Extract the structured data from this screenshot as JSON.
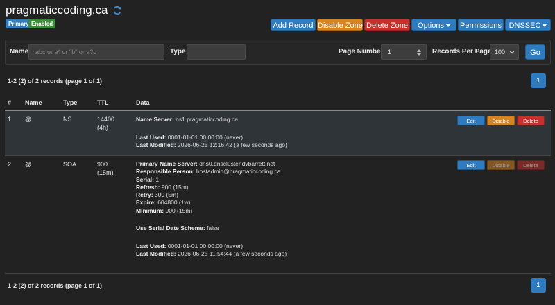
{
  "zone": {
    "name": "pragmaticcoding.ca",
    "badges": {
      "type": "Primary",
      "status": "Enabled"
    }
  },
  "toolbar": {
    "add_record": "Add Record",
    "disable_zone": "Disable Zone",
    "delete_zone": "Delete Zone",
    "options": "Options",
    "permissions": "Permissions",
    "dnssec": "DNSSEC"
  },
  "filter": {
    "name_label": "Name",
    "name_placeholder": "abc or a* or \"b\" or a?c",
    "type_label": "Type",
    "type_value": "",
    "page_number_label": "Page Number",
    "page_number_value": "1",
    "records_per_page_label": "Records Per Page",
    "records_per_page_value": "100",
    "go_label": "Go"
  },
  "summary": {
    "top": "1-2 (2) of 2 records (page 1 of 1)",
    "bottom": "1-2 (2) of 2 records (page 1 of 1)",
    "page": "1"
  },
  "table": {
    "headers": {
      "num": "#",
      "name": "Name",
      "type": "Type",
      "ttl": "TTL",
      "data": "Data"
    },
    "rows": [
      {
        "num": "1",
        "name": "@",
        "type": "NS",
        "ttl": "14400",
        "ttl_human": "(4h)",
        "data": [
          {
            "label": "Name Server:",
            "value": " ns1.pragmaticcoding.ca"
          },
          {
            "label": "",
            "value": ""
          },
          {
            "label": "Last Used:",
            "value": " 0001-01-01 00:00:00 (never)"
          },
          {
            "label": "Last Modified:",
            "value": " 2026-06-25 12:16:42 (a few seconds ago)"
          }
        ],
        "actions": {
          "edit": "Edit",
          "disable": "Disable",
          "delete": "Delete"
        }
      },
      {
        "num": "2",
        "name": "@",
        "type": "SOA",
        "ttl": "900",
        "ttl_human": "(15m)",
        "data": [
          {
            "label": "Primary Name Server:",
            "value": " dns0.dnscluster.dvbarrett.net"
          },
          {
            "label": "Responsible Person:",
            "value": " hostadmin@pragmaticcoding.ca"
          },
          {
            "label": "Serial:",
            "value": " 1"
          },
          {
            "label": "Refresh:",
            "value": " 900 (15m)"
          },
          {
            "label": "Retry:",
            "value": " 300 (5m)"
          },
          {
            "label": "Expire:",
            "value": " 604800 (1w)"
          },
          {
            "label": "Minimum:",
            "value": " 900 (15m)"
          },
          {
            "label": "",
            "value": ""
          },
          {
            "label": "Use Serial Date Scheme:",
            "value": " false"
          },
          {
            "label": "",
            "value": ""
          },
          {
            "label": "Last Used:",
            "value": " 0001-01-01 00:00:00 (never)"
          },
          {
            "label": "Last Modified:",
            "value": " 2026-06-25 11:54:44 (a few seconds ago)"
          }
        ],
        "actions": {
          "edit": "Edit",
          "disable": "Disable",
          "delete": "Delete"
        }
      }
    ]
  },
  "colors": {
    "background": "#222222",
    "primary": "#2f7bbf",
    "warning": "#d9851f",
    "danger": "#c9302c",
    "success": "#3c8a3c"
  },
  "icons": {
    "refresh": "refresh-icon",
    "spinner": "updown-arrows-icon",
    "select": "chevron-down-icon"
  }
}
